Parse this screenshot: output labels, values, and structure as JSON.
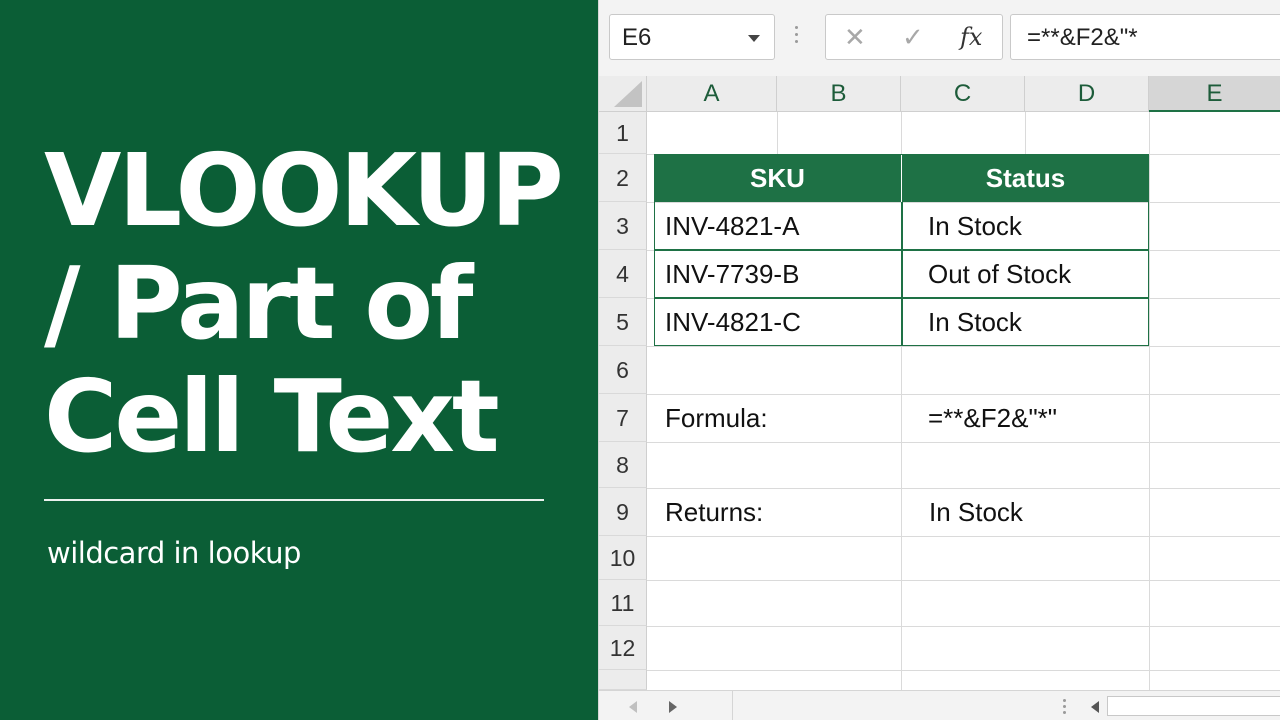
{
  "title": {
    "line1": "VLOOKUP",
    "line2": "/ Part of",
    "line3": "Cell Text",
    "subtitle": "wildcard in lookup"
  },
  "formula_bar": {
    "name_box": "E6",
    "cancel_icon": "✕",
    "enter_icon": "✓",
    "fx_label": "fx",
    "formula": "=**&F2&\"*"
  },
  "columns": [
    "A",
    "B",
    "C",
    "D",
    "E"
  ],
  "selected_column": "E",
  "rows": [
    "1",
    "2",
    "3",
    "4",
    "5",
    "6",
    "7",
    "8",
    "9",
    "10",
    "11",
    "12"
  ],
  "table": {
    "headers": [
      "SKU",
      "Status"
    ],
    "rows": [
      [
        "INV-4821-A",
        "In Stock"
      ],
      [
        "INV-7739-B",
        "Out of Stock"
      ],
      [
        "INV-4821-C",
        "In Stock"
      ]
    ]
  },
  "labels": {
    "formula_label": "Formula:",
    "formula_value": "=**&F2&\"*\"",
    "returns_label": "Returns:",
    "returns_value": "In Stock"
  },
  "colors": {
    "panel_green": "#0b5e36",
    "table_header_green": "#1e7145"
  }
}
